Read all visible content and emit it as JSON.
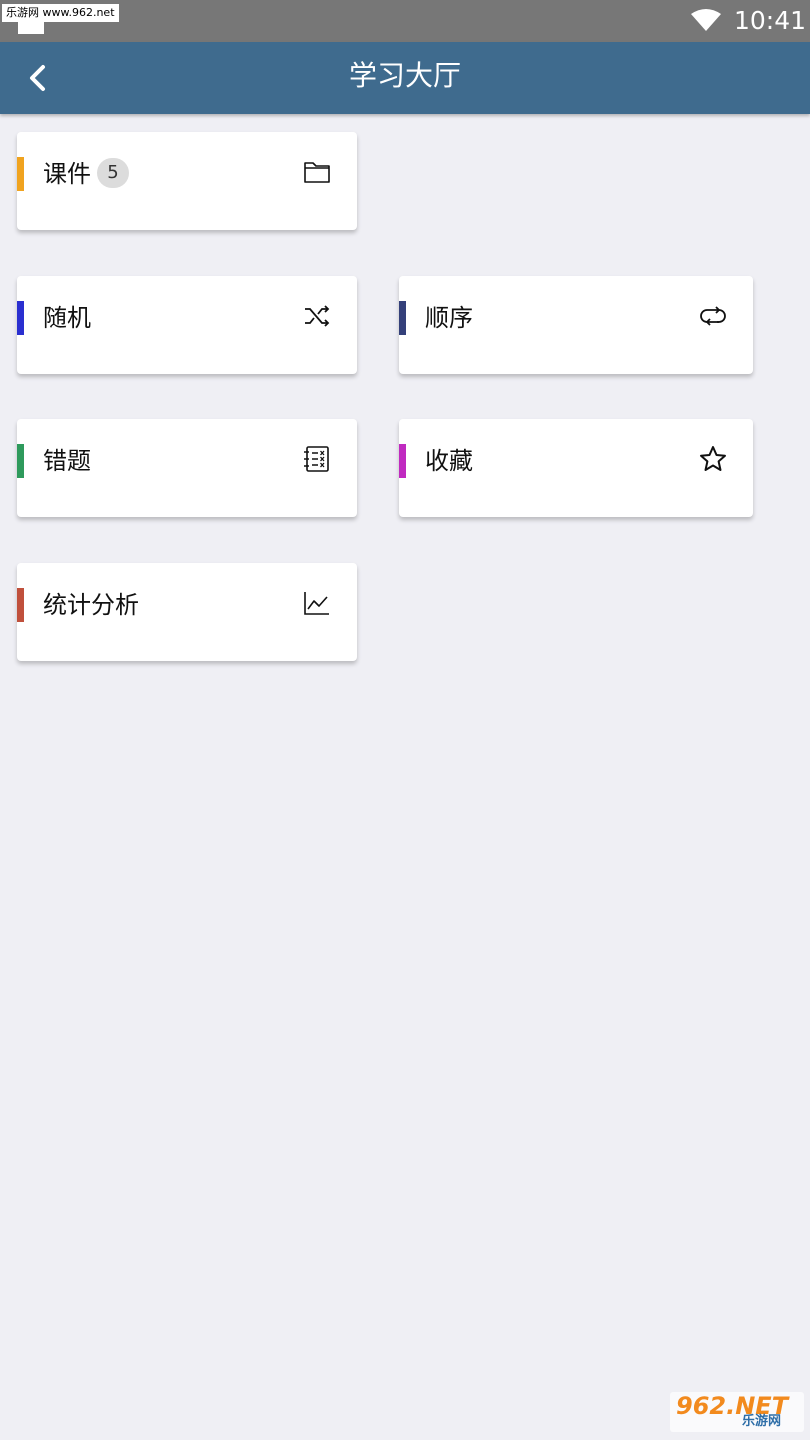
{
  "status_bar": {
    "watermark": "乐游网 www.962.net",
    "time": "10:41"
  },
  "header": {
    "title": "学习大厅"
  },
  "cards": {
    "courseware": {
      "label": "课件",
      "badge": "5",
      "accent": "#f0a31f",
      "icon": "folder-icon"
    },
    "random": {
      "label": "随机",
      "accent": "#2a2fd0",
      "icon": "shuffle-icon"
    },
    "sequence": {
      "label": "顺序",
      "accent": "#34407a",
      "icon": "repeat-icon"
    },
    "mistakes": {
      "label": "错题",
      "accent": "#2e9a5c",
      "icon": "checklist-icon"
    },
    "favorites": {
      "label": "收藏",
      "accent": "#c02ac0",
      "icon": "star-icon"
    },
    "statistics": {
      "label": "统计分析",
      "accent": "#c0503c",
      "icon": "line-chart-icon"
    }
  },
  "watermark_bottom": {
    "main": "962.NET",
    "sub": "乐游网"
  },
  "colors": {
    "header_bg": "#3f6b8e",
    "page_bg": "#efeff4",
    "status_bg": "#777777"
  }
}
